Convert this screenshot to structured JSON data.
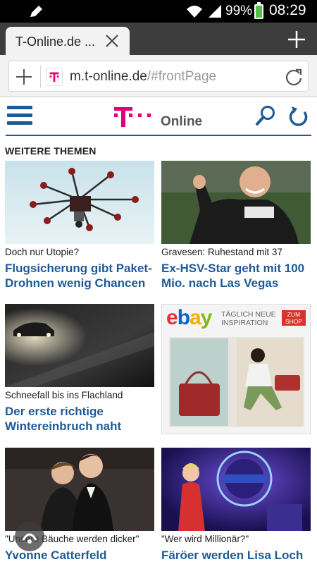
{
  "status": {
    "battery_percent_label": "99%",
    "battery_level": 0.99,
    "time": "08:29"
  },
  "browser": {
    "tab_title": "T-Online.de ...",
    "url_host": "m.t-online.de",
    "url_path": "/#frontPage"
  },
  "site": {
    "logo_text": "Online",
    "section_title": "WEITERE THEMEN",
    "brand_color": "#1e5a96",
    "telekom_color": "#e20074"
  },
  "articles": [
    {
      "kicker": "Doch nur Utopie?",
      "headline": "Flugsicherung gibt Paket-Drohnen wenig Chancen"
    },
    {
      "kicker": "Gravesen: Ruhestand mit 37",
      "headline": "Ex-HSV-Star geht mit 100 Mio. nach Las Vegas"
    },
    {
      "kicker": "Schneefall bis ins Flachland",
      "headline": "Der erste richtige Wintereinbruch naht"
    },
    {
      "kicker": "\"Unsere Bäuche werden dicker\"",
      "headline": "Yvonne Catterfeld erwartet"
    },
    {
      "kicker": "\"Wer wird Millionär?\"",
      "headline": "Färöer werden Lisa Loch"
    }
  ],
  "ad": {
    "brand": "ebay",
    "tagline": "TÄGLICH NEUE INSPIRATION",
    "cta": "ZUM SHOP"
  }
}
